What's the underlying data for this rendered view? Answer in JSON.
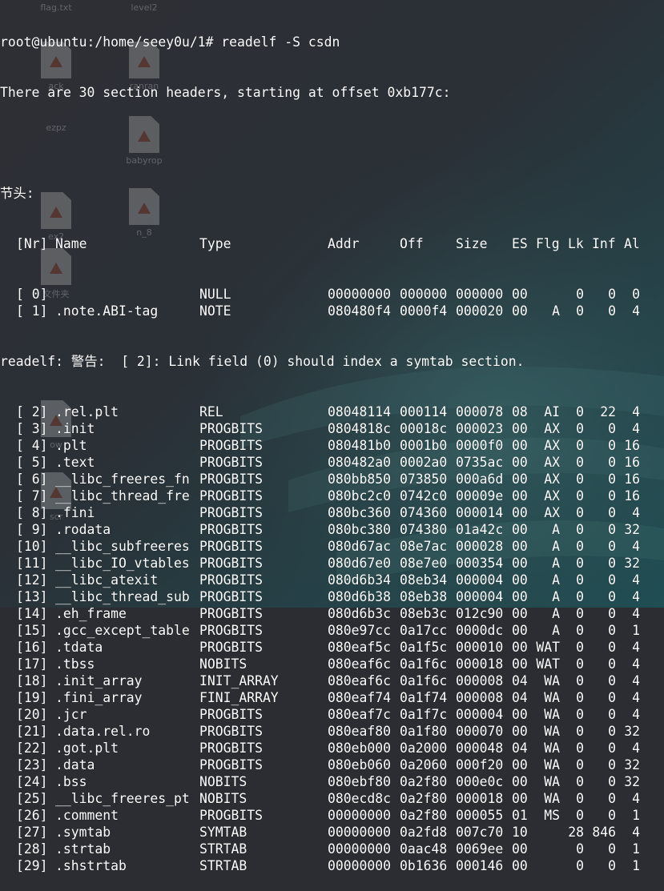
{
  "desktop_icons": [
    "flag.txt",
    "level2",
    "ack",
    "ranran",
    "babyrop",
    "n_8",
    "文件夹",
    "ezpz",
    "ex2",
    "ow",
    "scr"
  ],
  "terminal": {
    "prompt": "root@ubuntu:/home/seey0u/1# readelf -S csdn",
    "summary": "There are 30 section headers, starting at offset 0xb177c:",
    "section_label": "节头:",
    "headers": [
      "[Nr]",
      "Name",
      "Type",
      "Addr",
      "Off",
      "Size",
      "ES",
      "Flg",
      "Lk",
      "Inf",
      "Al"
    ],
    "warning": "readelf: 警告:  [ 2]: Link field (0) should index a symtab section.",
    "sections": [
      {
        "nr": "[ 0]",
        "name": "",
        "type": "NULL",
        "addr": "00000000",
        "off": "000000",
        "size": "000000",
        "es": "00",
        "flg": "",
        "lk": "0",
        "inf": "0",
        "al": "0"
      },
      {
        "nr": "[ 1]",
        "name": ".note.ABI-tag",
        "type": "NOTE",
        "addr": "080480f4",
        "off": "0000f4",
        "size": "000020",
        "es": "00",
        "flg": "A",
        "lk": "0",
        "inf": "0",
        "al": "4"
      },
      {
        "nr": "[ 2]",
        "name": ".rel.plt",
        "type": "REL",
        "addr": "08048114",
        "off": "000114",
        "size": "000078",
        "es": "08",
        "flg": "AI",
        "lk": "0",
        "inf": "22",
        "al": "4"
      },
      {
        "nr": "[ 3]",
        "name": ".init",
        "type": "PROGBITS",
        "addr": "0804818c",
        "off": "00018c",
        "size": "000023",
        "es": "00",
        "flg": "AX",
        "lk": "0",
        "inf": "0",
        "al": "4"
      },
      {
        "nr": "[ 4]",
        "name": ".plt",
        "type": "PROGBITS",
        "addr": "080481b0",
        "off": "0001b0",
        "size": "0000f0",
        "es": "00",
        "flg": "AX",
        "lk": "0",
        "inf": "0",
        "al": "16"
      },
      {
        "nr": "[ 5]",
        "name": ".text",
        "type": "PROGBITS",
        "addr": "080482a0",
        "off": "0002a0",
        "size": "0735ac",
        "es": "00",
        "flg": "AX",
        "lk": "0",
        "inf": "0",
        "al": "16"
      },
      {
        "nr": "[ 6]",
        "name": "__libc_freeres_fn",
        "type": "PROGBITS",
        "addr": "080bb850",
        "off": "073850",
        "size": "000a6d",
        "es": "00",
        "flg": "AX",
        "lk": "0",
        "inf": "0",
        "al": "16"
      },
      {
        "nr": "[ 7]",
        "name": "__libc_thread_fre",
        "type": "PROGBITS",
        "addr": "080bc2c0",
        "off": "0742c0",
        "size": "00009e",
        "es": "00",
        "flg": "AX",
        "lk": "0",
        "inf": "0",
        "al": "16"
      },
      {
        "nr": "[ 8]",
        "name": ".fini",
        "type": "PROGBITS",
        "addr": "080bc360",
        "off": "074360",
        "size": "000014",
        "es": "00",
        "flg": "AX",
        "lk": "0",
        "inf": "0",
        "al": "4"
      },
      {
        "nr": "[ 9]",
        "name": ".rodata",
        "type": "PROGBITS",
        "addr": "080bc380",
        "off": "074380",
        "size": "01a42c",
        "es": "00",
        "flg": "A",
        "lk": "0",
        "inf": "0",
        "al": "32"
      },
      {
        "nr": "[10]",
        "name": "__libc_subfreeres",
        "type": "PROGBITS",
        "addr": "080d67ac",
        "off": "08e7ac",
        "size": "000028",
        "es": "00",
        "flg": "A",
        "lk": "0",
        "inf": "0",
        "al": "4"
      },
      {
        "nr": "[11]",
        "name": "__libc_IO_vtables",
        "type": "PROGBITS",
        "addr": "080d67e0",
        "off": "08e7e0",
        "size": "000354",
        "es": "00",
        "flg": "A",
        "lk": "0",
        "inf": "0",
        "al": "32"
      },
      {
        "nr": "[12]",
        "name": "__libc_atexit",
        "type": "PROGBITS",
        "addr": "080d6b34",
        "off": "08eb34",
        "size": "000004",
        "es": "00",
        "flg": "A",
        "lk": "0",
        "inf": "0",
        "al": "4"
      },
      {
        "nr": "[13]",
        "name": "__libc_thread_sub",
        "type": "PROGBITS",
        "addr": "080d6b38",
        "off": "08eb38",
        "size": "000004",
        "es": "00",
        "flg": "A",
        "lk": "0",
        "inf": "0",
        "al": "4"
      },
      {
        "nr": "[14]",
        "name": ".eh_frame",
        "type": "PROGBITS",
        "addr": "080d6b3c",
        "off": "08eb3c",
        "size": "012c90",
        "es": "00",
        "flg": "A",
        "lk": "0",
        "inf": "0",
        "al": "4"
      },
      {
        "nr": "[15]",
        "name": ".gcc_except_table",
        "type": "PROGBITS",
        "addr": "080e97cc",
        "off": "0a17cc",
        "size": "0000dc",
        "es": "00",
        "flg": "A",
        "lk": "0",
        "inf": "0",
        "al": "1"
      },
      {
        "nr": "[16]",
        "name": ".tdata",
        "type": "PROGBITS",
        "addr": "080eaf5c",
        "off": "0a1f5c",
        "size": "000010",
        "es": "00",
        "flg": "WAT",
        "lk": "0",
        "inf": "0",
        "al": "4"
      },
      {
        "nr": "[17]",
        "name": ".tbss",
        "type": "NOBITS",
        "addr": "080eaf6c",
        "off": "0a1f6c",
        "size": "000018",
        "es": "00",
        "flg": "WAT",
        "lk": "0",
        "inf": "0",
        "al": "4"
      },
      {
        "nr": "[18]",
        "name": ".init_array",
        "type": "INIT_ARRAY",
        "addr": "080eaf6c",
        "off": "0a1f6c",
        "size": "000008",
        "es": "04",
        "flg": "WA",
        "lk": "0",
        "inf": "0",
        "al": "4"
      },
      {
        "nr": "[19]",
        "name": ".fini_array",
        "type": "FINI_ARRAY",
        "addr": "080eaf74",
        "off": "0a1f74",
        "size": "000008",
        "es": "04",
        "flg": "WA",
        "lk": "0",
        "inf": "0",
        "al": "4"
      },
      {
        "nr": "[20]",
        "name": ".jcr",
        "type": "PROGBITS",
        "addr": "080eaf7c",
        "off": "0a1f7c",
        "size": "000004",
        "es": "00",
        "flg": "WA",
        "lk": "0",
        "inf": "0",
        "al": "4"
      },
      {
        "nr": "[21]",
        "name": ".data.rel.ro",
        "type": "PROGBITS",
        "addr": "080eaf80",
        "off": "0a1f80",
        "size": "000070",
        "es": "00",
        "flg": "WA",
        "lk": "0",
        "inf": "0",
        "al": "32"
      },
      {
        "nr": "[22]",
        "name": ".got.plt",
        "type": "PROGBITS",
        "addr": "080eb000",
        "off": "0a2000",
        "size": "000048",
        "es": "04",
        "flg": "WA",
        "lk": "0",
        "inf": "0",
        "al": "4"
      },
      {
        "nr": "[23]",
        "name": ".data",
        "type": "PROGBITS",
        "addr": "080eb060",
        "off": "0a2060",
        "size": "000f20",
        "es": "00",
        "flg": "WA",
        "lk": "0",
        "inf": "0",
        "al": "32"
      },
      {
        "nr": "[24]",
        "name": ".bss",
        "type": "NOBITS",
        "addr": "080ebf80",
        "off": "0a2f80",
        "size": "000e0c",
        "es": "00",
        "flg": "WA",
        "lk": "0",
        "inf": "0",
        "al": "32"
      },
      {
        "nr": "[25]",
        "name": "__libc_freeres_pt",
        "type": "NOBITS",
        "addr": "080ecd8c",
        "off": "0a2f80",
        "size": "000018",
        "es": "00",
        "flg": "WA",
        "lk": "0",
        "inf": "0",
        "al": "4"
      },
      {
        "nr": "[26]",
        "name": ".comment",
        "type": "PROGBITS",
        "addr": "00000000",
        "off": "0a2f80",
        "size": "000055",
        "es": "01",
        "flg": "MS",
        "lk": "0",
        "inf": "0",
        "al": "1"
      },
      {
        "nr": "[27]",
        "name": ".symtab",
        "type": "SYMTAB",
        "addr": "00000000",
        "off": "0a2fd8",
        "size": "007c70",
        "es": "10",
        "flg": "",
        "lk": "28",
        "inf": "846",
        "al": "4"
      },
      {
        "nr": "[28]",
        "name": ".strtab",
        "type": "STRTAB",
        "addr": "00000000",
        "off": "0aac48",
        "size": "0069ee",
        "es": "00",
        "flg": "",
        "lk": "0",
        "inf": "0",
        "al": "1"
      },
      {
        "nr": "[29]",
        "name": ".shstrtab",
        "type": "STRTAB",
        "addr": "00000000",
        "off": "0b1636",
        "size": "000146",
        "es": "00",
        "flg": "",
        "lk": "0",
        "inf": "0",
        "al": "1"
      }
    ]
  },
  "colors": {
    "text": "#ffffff",
    "background_top": "#2a2c33",
    "background_bottom": "#1f4a52"
  }
}
